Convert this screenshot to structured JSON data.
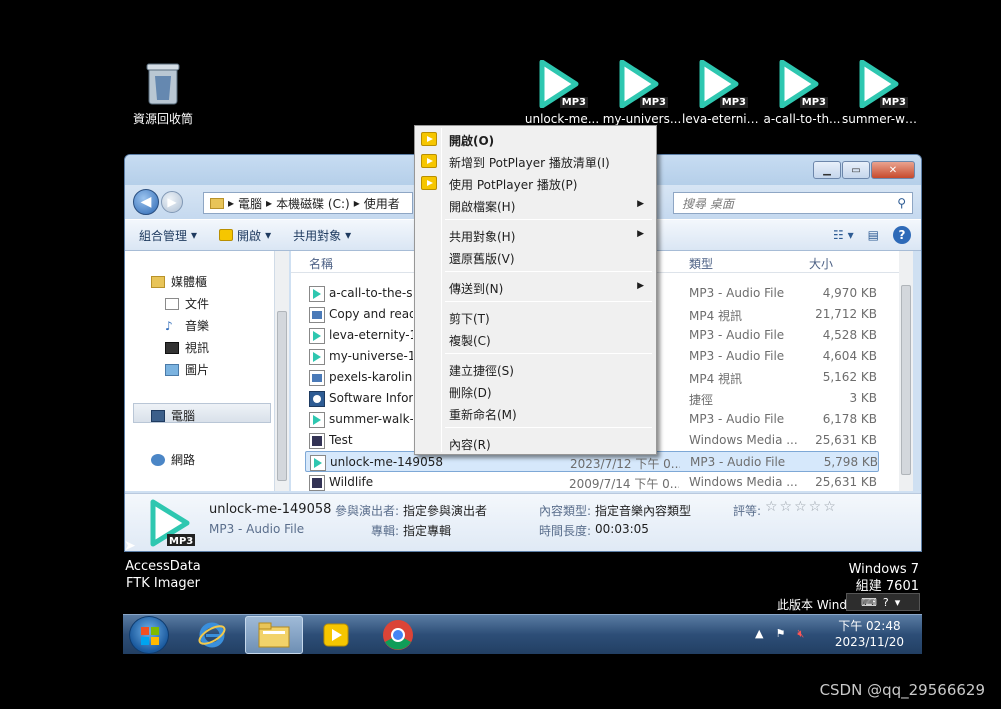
{
  "desktop": {
    "recycle_bin": "資源回收筒",
    "mp3_icons": [
      {
        "label": "unlock-me...",
        "tag": "MP3"
      },
      {
        "label": "my-univers...",
        "tag": "MP3"
      },
      {
        "label": "leva-eternit...",
        "tag": "MP3"
      },
      {
        "label": "a-call-to-th...",
        "tag": "MP3"
      },
      {
        "label": "summer-wa...",
        "tag": "MP3"
      }
    ],
    "bottom_icon_line1": "AccessData",
    "bottom_icon_line2": "FTK Imager",
    "win7_line1": "Windows 7",
    "win7_line2": "組建 7601",
    "not_genuine": "此版本 Wind"
  },
  "window": {
    "address": [
      "電腦",
      "本機磁碟 (C:)",
      "使用者"
    ],
    "search_placeholder": "搜尋 桌面",
    "toolbar": {
      "organize": "組合管理",
      "open": "開啟",
      "share": "共用對象"
    },
    "nav": {
      "favorites": "媒體櫃",
      "documents": "文件",
      "music": "音樂",
      "videos": "視訊",
      "pictures": "圖片",
      "computer": "電腦",
      "network": "網路"
    },
    "columns": {
      "name": "名稱",
      "type": "類型",
      "size": "大小"
    },
    "files": [
      {
        "name": "a-call-to-the-soul",
        "date": "0...",
        "type": "MP3 - Audio File",
        "size": "4,970 KB"
      },
      {
        "name": "Copy and read",
        "date": "1...",
        "type": "MP4 視訊",
        "size": "21,712 KB"
      },
      {
        "name": "leva-eternity-14",
        "date": "1...",
        "type": "MP3 - Audio File",
        "size": "4,528 KB"
      },
      {
        "name": "my-universe-14",
        "date": "1...",
        "type": "MP3 - Audio File",
        "size": "4,604 KB"
      },
      {
        "name": "pexels-karolina",
        "date": "0...",
        "type": "MP4 視訊",
        "size": "5,162 KB"
      },
      {
        "name": "Software Inform",
        "date": "1...",
        "type": "捷徑",
        "size": "3 KB"
      },
      {
        "name": "summer-walk-1",
        "date": "1...",
        "type": "MP3 - Audio File",
        "size": "6,178 KB"
      },
      {
        "name": "Test",
        "date": "1...",
        "type": "Windows Media ...",
        "size": "25,631 KB"
      },
      {
        "name": "unlock-me-149058",
        "date": "2023/7/12 下午 0...",
        "type": "MP3 - Audio File",
        "size": "5,798 KB"
      },
      {
        "name": "Wildlife",
        "date": "2009/7/14 下午 0...",
        "type": "Windows Media ...",
        "size": "25,631 KB"
      }
    ],
    "details": {
      "filename": "unlock-me-149058",
      "filetype": "MP3 - Audio File",
      "artist_label": "參與演出者:",
      "artist_value": "指定參與演出者",
      "album_label": "專輯:",
      "album_value": "指定專輯",
      "genre_label": "內容類型:",
      "genre_value": "指定音樂內容類型",
      "length_label": "時間長度:",
      "length_value": "00:03:05",
      "rating_label": "評等:",
      "stars": "☆☆☆☆☆"
    }
  },
  "context_menu": [
    {
      "label": "開啟(O)",
      "bold": true,
      "icon": "potplayer"
    },
    {
      "label": "新增到 PotPlayer 播放清單(I)",
      "icon": "potplayer"
    },
    {
      "label": "使用 PotPlayer 播放(P)",
      "icon": "potplayer"
    },
    {
      "label": "開啟檔案(H)",
      "submenu": true
    },
    {
      "label": "共用對象(H)",
      "submenu": true
    },
    {
      "label": "還原舊版(V)"
    },
    {
      "label": "傳送到(N)",
      "submenu": true
    },
    {
      "label": "剪下(T)"
    },
    {
      "label": "複製(C)"
    },
    {
      "label": "建立捷徑(S)"
    },
    {
      "label": "刪除(D)"
    },
    {
      "label": "重新命名(M)"
    },
    {
      "label": "內容(R)"
    }
  ],
  "taskbar": {
    "time": "下午 02:48",
    "date": "2023/11/20"
  },
  "watermark": "CSDN @qq_29566629"
}
